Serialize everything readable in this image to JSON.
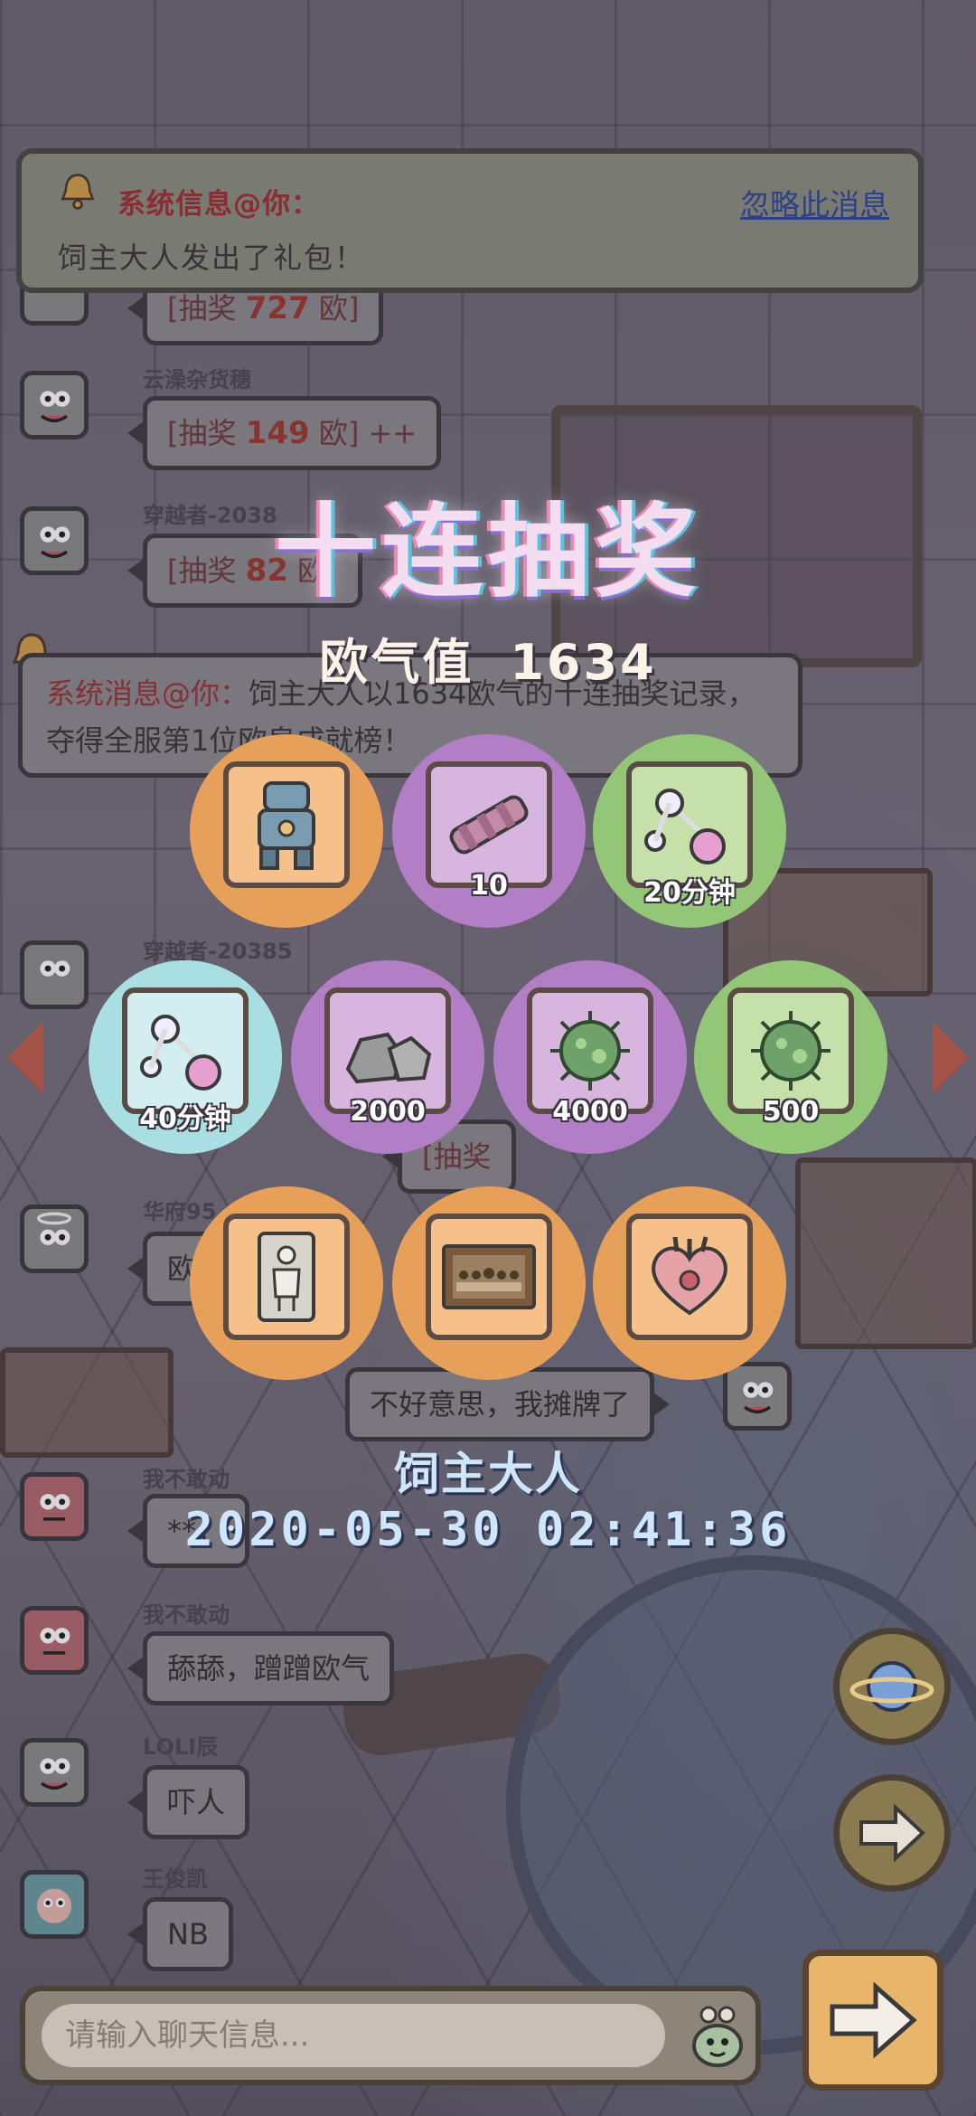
{
  "banner": {
    "title": "系统信息@你：",
    "message": "饲主大人发出了礼包！",
    "ignore_label": "忽略此消息"
  },
  "chat": {
    "messages": [
      {
        "user": "",
        "text_pre": "[抽奖 ",
        "number": "727",
        "text_post": " 欧]"
      },
      {
        "user": "云澡杂货穗",
        "text_pre": "[抽奖 ",
        "number": "149",
        "text_post": " 欧] ++"
      },
      {
        "user": "穿越者-2038",
        "text_pre": "[抽奖 ",
        "number": "82",
        "text_post": " 欧]"
      },
      {
        "user": "穿越者-20385",
        "text": ""
      },
      {
        "user": "",
        "text_pre": "[抽奖 ",
        "number": "",
        "text_post": ""
      },
      {
        "user": "华府95",
        "text": "欧"
      },
      {
        "user": "",
        "text": "不好意思，我摊牌了"
      },
      {
        "user": "我不敢动",
        "text": "**，"
      },
      {
        "user": "我不敢动",
        "text": "舔舔，蹭蹭欧气"
      },
      {
        "user": "LOLI辰",
        "text": "吓人"
      },
      {
        "user": "王俊凯",
        "text": "NB"
      }
    ],
    "system_message": {
      "label": "系统消息@你：",
      "text": "饲主大人以1634欧气的十连抽奖记录，夺得全服第1位欧皇成就榜！"
    }
  },
  "result": {
    "title": "十连抽奖",
    "luck_label": "欧气值",
    "luck_value": "1634",
    "prizes": [
      {
        "item": "robot-armor-icon",
        "qty": "",
        "bg": "orange"
      },
      {
        "item": "telescope-icon",
        "qty": "10",
        "bg": "purple"
      },
      {
        "item": "potion-icon",
        "qty": "20分钟",
        "bg": "green"
      },
      {
        "item": "potion-icon",
        "qty": "40分钟",
        "bg": "cyan"
      },
      {
        "item": "stone-icon",
        "qty": "2000",
        "bg": "purple"
      },
      {
        "item": "virus-icon",
        "qty": "4000",
        "bg": "purple"
      },
      {
        "item": "virus-icon",
        "qty": "500",
        "bg": "green"
      },
      {
        "item": "sculpture-icon",
        "qty": "",
        "bg": "orange"
      },
      {
        "item": "painting-icon",
        "qty": "",
        "bg": "orange"
      },
      {
        "item": "heart-organ-icon",
        "qty": "",
        "bg": "orange"
      }
    ],
    "winner": "饲主大人",
    "datetime": "2020-05-30 02:41:36"
  },
  "input": {
    "placeholder": "请输入聊天信息..."
  },
  "colors": {
    "orange": "#e7a05a",
    "purple": "#b27ec6",
    "green": "#94c677",
    "cyan": "#a9dfe3",
    "title_glow": "#5bc2e0"
  }
}
